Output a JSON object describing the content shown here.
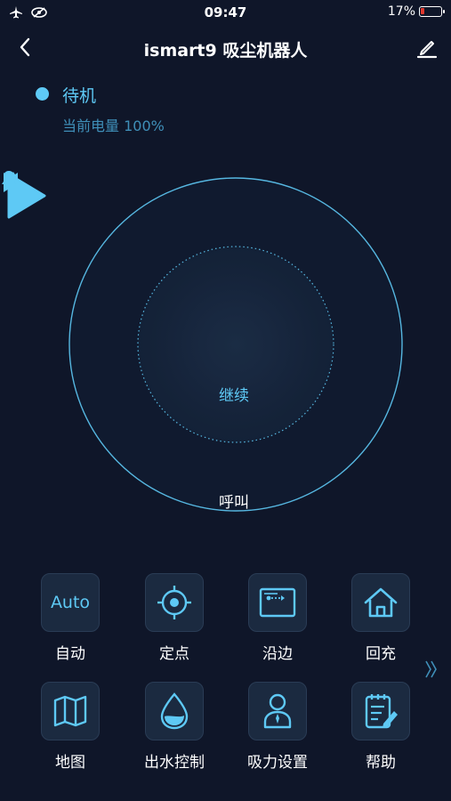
{
  "status_bar": {
    "time": "09:47",
    "battery_percent_text": "17%",
    "battery_level": 0.17,
    "icons": [
      "airplane-icon",
      "do-not-disturb-icon"
    ]
  },
  "nav": {
    "title": "ismart9 吸尘机器人",
    "back_icon": "back-chevron-icon",
    "edit_icon": "edit-pencil-icon"
  },
  "robot": {
    "state": "待机",
    "battery": "当前电量 100%"
  },
  "controller": {
    "center_label": "继续",
    "call_label": "呼叫"
  },
  "functions": [
    {
      "label": "自动",
      "icon": "auto-text-icon",
      "icon_text": "Auto"
    },
    {
      "label": "定点",
      "icon": "target-icon"
    },
    {
      "label": "沿边",
      "icon": "edge-icon"
    },
    {
      "label": "回充",
      "icon": "home-icon"
    },
    {
      "label": "地图",
      "icon": "map-icon"
    },
    {
      "label": "出水控制",
      "icon": "water-drop-icon"
    },
    {
      "label": "吸力设置",
      "icon": "suction-person-icon"
    },
    {
      "label": "帮助",
      "icon": "help-notebook-icon"
    }
  ],
  "colors": {
    "background": "#0f1629",
    "accent": "#5ec9f5",
    "accent_dim": "#3f8fb8",
    "tile": "#1b2a40"
  }
}
